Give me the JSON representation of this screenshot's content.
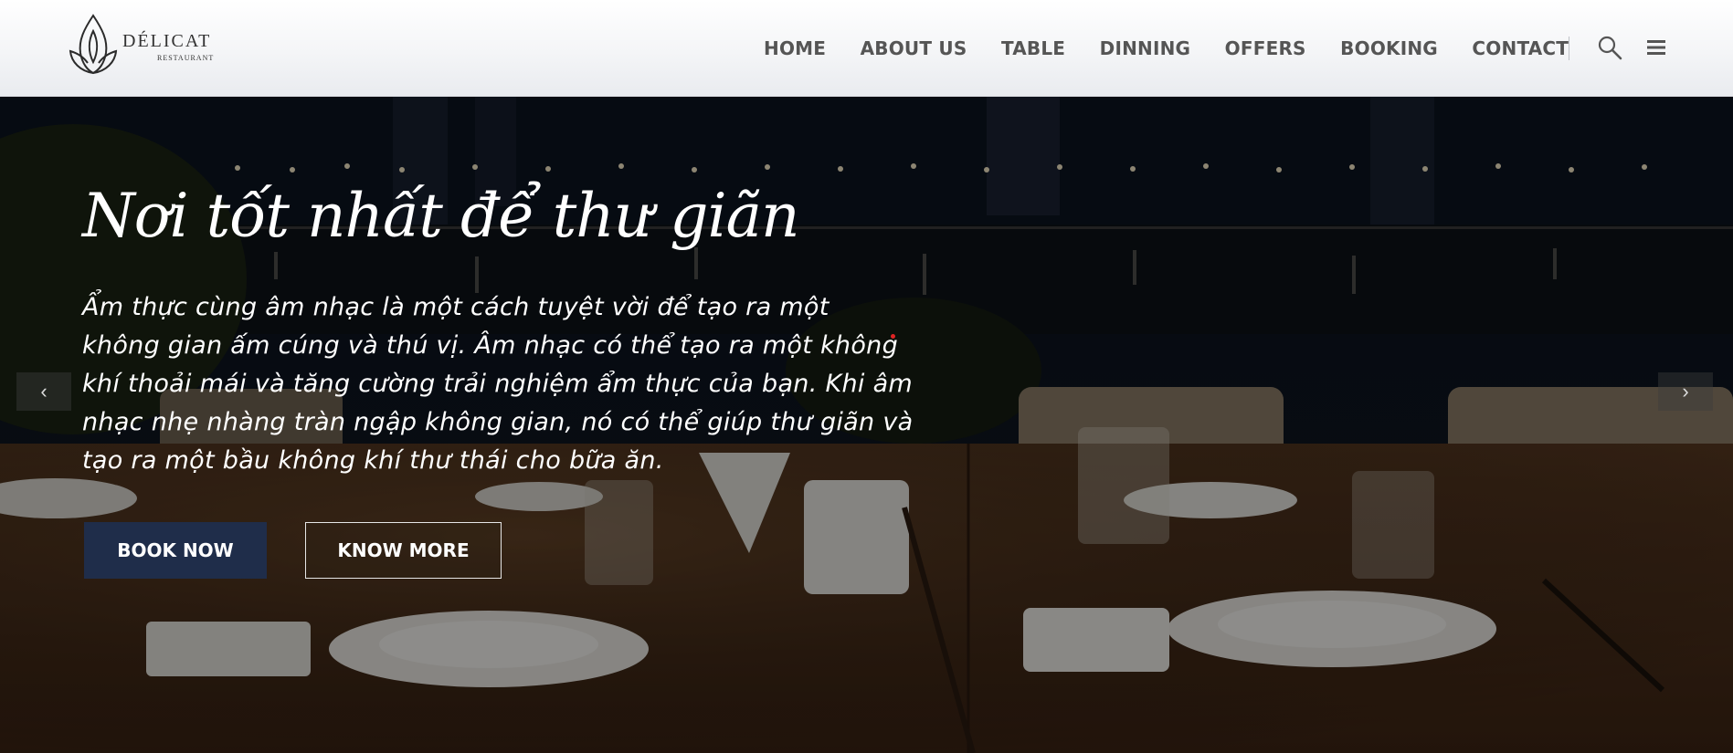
{
  "brand": {
    "name": "DÉLICAT",
    "subtitle": "RESTAURANT",
    "accent_color": "#1f2d4a"
  },
  "nav": {
    "items": [
      {
        "label": "HOME"
      },
      {
        "label": "ABOUT US"
      },
      {
        "label": "TABLE"
      },
      {
        "label": "DINNING"
      },
      {
        "label": "OFFERS"
      },
      {
        "label": "BOOKING"
      },
      {
        "label": "CONTACT"
      }
    ],
    "icons": [
      "search-icon",
      "hamburger-menu-icon"
    ]
  },
  "hero": {
    "title": "Nơi tốt nhất để thư giãn",
    "description": "Ẩm thực cùng âm nhạc là một cách tuyệt vời để tạo ra một không gian ấm cúng và thú vị. Âm nhạc có thể tạo ra một không khí thoải mái và tăng cường trải nghiệm ẩm thực của bạn. Khi âm nhạc nhẹ nhàng tràn ngập không gian, nó có thể giúp thư giãn và tạo ra một bầu không khí thư thái cho bữa ăn.",
    "buttons": {
      "book_now": "BOOK NOW",
      "know_more": "KNOW MORE"
    },
    "carousel": {
      "prev_glyph": "‹",
      "next_glyph": "›"
    }
  }
}
